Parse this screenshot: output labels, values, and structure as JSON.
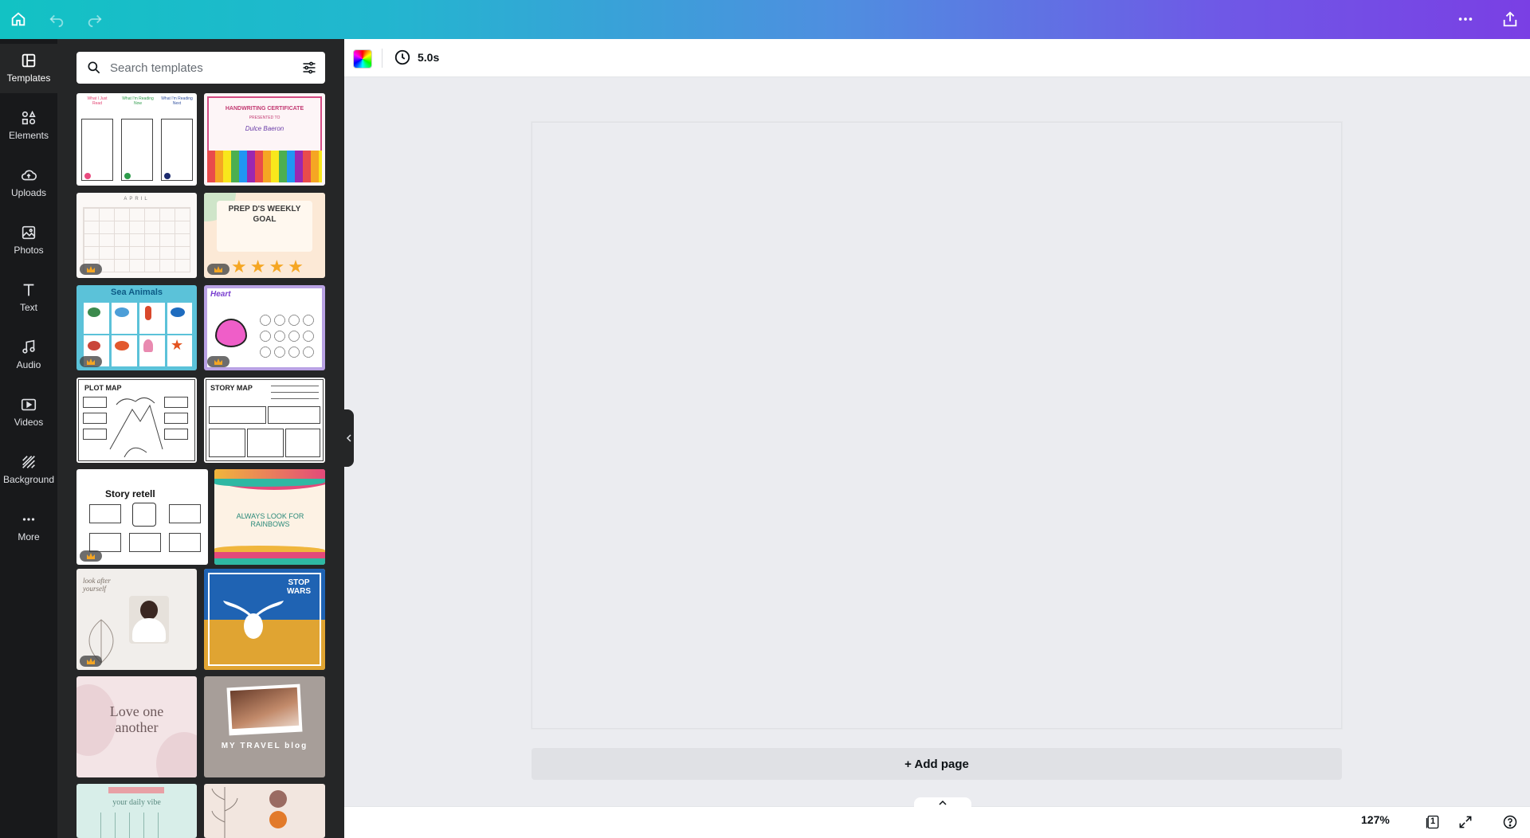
{
  "topbar": {
    "home_icon": "home-icon",
    "undo_icon": "undo-icon",
    "redo_icon": "redo-icon",
    "more_icon": "more-horizontal-icon",
    "share_icon": "share-icon",
    "gradient_colors": [
      "#12c2c4",
      "#4f8ee0",
      "#7a3fe4"
    ]
  },
  "rail": {
    "items": [
      {
        "label": "Templates",
        "icon": "templates-icon",
        "active": true
      },
      {
        "label": "Elements",
        "icon": "elements-icon"
      },
      {
        "label": "Uploads",
        "icon": "upload-cloud-icon"
      },
      {
        "label": "Photos",
        "icon": "photo-icon"
      },
      {
        "label": "Text",
        "icon": "text-icon"
      },
      {
        "label": "Audio",
        "icon": "music-note-icon"
      },
      {
        "label": "Videos",
        "icon": "video-icon"
      },
      {
        "label": "Background",
        "icon": "background-icon"
      },
      {
        "label": "More",
        "icon": "more-horizontal-icon"
      }
    ]
  },
  "search": {
    "placeholder": "Search templates",
    "value": ""
  },
  "templates": {
    "reading_tracker": {
      "col1": "What I Just Read",
      "col2": "What I'm Reading Now",
      "col3": "What I'm Reading Next"
    },
    "certificate": {
      "title": "HANDWRITING CERTIFICATE",
      "presented": "PRESENTED TO",
      "name": "Dulce Baeron"
    },
    "calendar": {
      "month": "APRIL"
    },
    "weekly_goal": {
      "title": "PREP D'S WEEKLY GOAL"
    },
    "sea_animals": {
      "title": "Sea Animals"
    },
    "heart": {
      "title": "Heart"
    },
    "plot_map": {
      "title": "PLOT MAP"
    },
    "story_map": {
      "title": "STORY MAP"
    },
    "story_retell": {
      "title": "Story retell"
    },
    "rainbows": {
      "text": "ALWAYS LOOK FOR RAINBOWS"
    },
    "look_after": {
      "text": "look after yourself"
    },
    "stop_wars": {
      "text": "STOP WARS"
    },
    "love": {
      "text": "Love one another"
    },
    "travel": {
      "text": "MY TRAVEL blog"
    },
    "daily_vibe": {
      "text": "your daily vibe"
    }
  },
  "toolbar": {
    "duration": "5.0s",
    "color_icon": "color-picker-icon",
    "timer_icon": "clock-icon"
  },
  "canvas": {
    "add_page_label": "+ Add page"
  },
  "bottombar": {
    "zoom": "127%",
    "page_count": "1",
    "notes_icon": "chevron-up-icon",
    "fullscreen_icon": "fullscreen-icon",
    "help_icon": "help-icon"
  }
}
